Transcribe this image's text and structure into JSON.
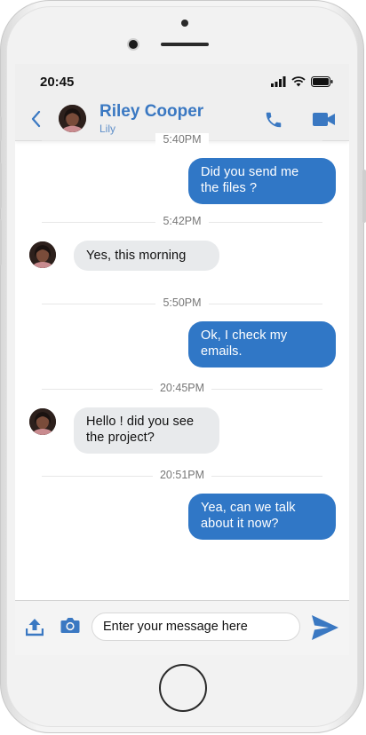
{
  "statusbar": {
    "time": "20:45"
  },
  "header": {
    "contact_name": "Riley Cooper",
    "contact_subtitle": "Lily"
  },
  "messages": [
    {
      "type": "divider",
      "label": "5:40PM"
    },
    {
      "type": "out",
      "lines": [
        "Did you send me",
        "the files ?"
      ]
    },
    {
      "type": "divider",
      "label": "5:42PM"
    },
    {
      "type": "in",
      "lines": [
        "Yes, this morning"
      ]
    },
    {
      "type": "divider",
      "label": "5:50PM"
    },
    {
      "type": "out",
      "lines": [
        "Ok, I check my",
        "emails."
      ]
    },
    {
      "type": "divider",
      "label": "20:45PM"
    },
    {
      "type": "in",
      "lines": [
        "Hello ! did you see",
        "the project?"
      ]
    },
    {
      "type": "divider",
      "label": "20:51PM"
    },
    {
      "type": "out",
      "lines": [
        "Yea, can we talk",
        "about it now?"
      ]
    }
  ],
  "composer": {
    "placeholder": "Enter your message here"
  },
  "icons": {
    "back": "chevron-left-icon",
    "call": "phone-icon",
    "video": "video-camera-icon",
    "upload": "upload-icon",
    "camera": "camera-icon",
    "send": "send-icon"
  },
  "colors": {
    "accent": "#3077c6",
    "incoming_bubble": "#e8eaec",
    "header_bg": "#efefef"
  }
}
